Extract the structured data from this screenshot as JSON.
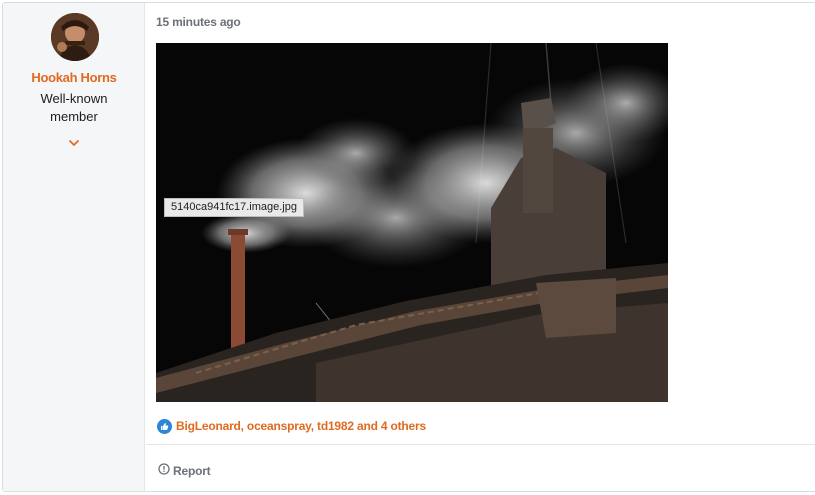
{
  "user": {
    "name": "Hookah Horns",
    "title": "Well-known member",
    "menu_icon": "chevron-down-icon"
  },
  "post": {
    "time": "15 minutes ago",
    "attachment_filename": "5140ca941fc17.image.jpg",
    "reactions_text": "BigLeonard, oceanspray, td1982 and 4 others",
    "report_label": "Report"
  },
  "colors": {
    "accent": "#e06a1f",
    "muted": "#6b7079",
    "like": "#2b86d8"
  }
}
